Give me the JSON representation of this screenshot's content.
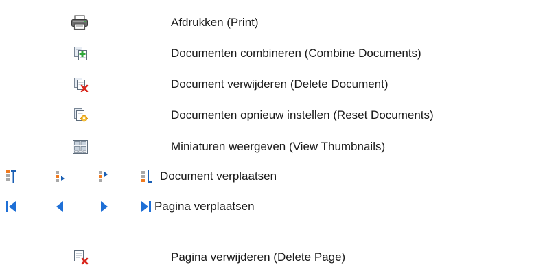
{
  "legend": {
    "items": [
      {
        "icon": "printer-icon",
        "label": "Afdrukken (Print)"
      },
      {
        "icon": "combine-documents-icon",
        "label": "Documenten combineren (Combine Documents)"
      },
      {
        "icon": "delete-document-icon",
        "label": "Document verwijderen (Delete Document)"
      },
      {
        "icon": "reset-documents-icon",
        "label": "Documenten opnieuw instellen (Reset Documents)"
      },
      {
        "icon": "thumbnails-icon",
        "label": "Miniaturen weergeven (View Thumbnails)"
      },
      {
        "icons": [
          "move-document-to-top-icon",
          "move-document-up-icon",
          "move-document-down-icon",
          "move-document-to-bottom-icon"
        ],
        "label": "Document verplaatsen"
      },
      {
        "icons": [
          "first-page-icon",
          "previous-page-icon",
          "next-page-icon",
          "last-page-icon"
        ],
        "label": "Pagina verplaatsen"
      },
      {
        "icon": "delete-page-icon",
        "label": "Pagina verwijderen (Delete Page)"
      }
    ]
  },
  "colors": {
    "text": "#1a1a1a",
    "nav_blue": "#1e6fd6",
    "doc_orange": "#f07a1e",
    "delete_red": "#d9261c",
    "add_green": "#2fa83a"
  }
}
